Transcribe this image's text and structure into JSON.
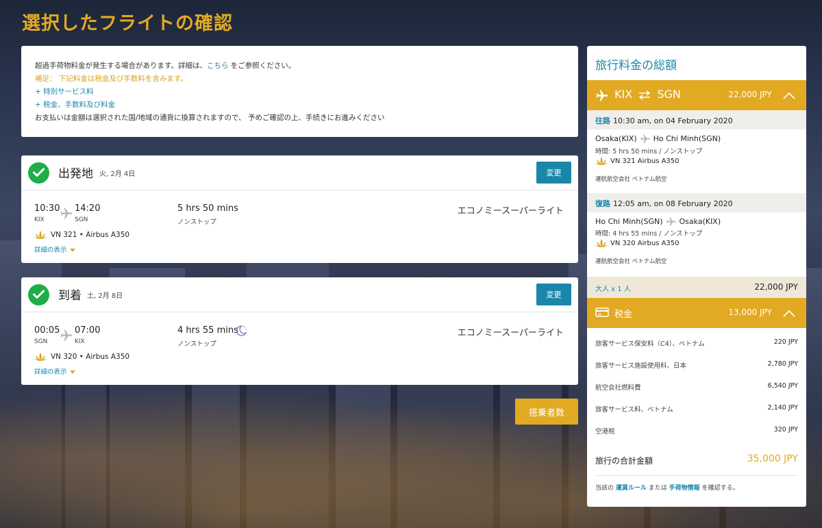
{
  "page": {
    "title": "選択したフライトの確認"
  },
  "notice": {
    "line1_pre": "超過手荷物料金が発生する場合があります。詳細は、",
    "line1_link": "こちら",
    "line1_post": "をご参照ください。",
    "line2": "補足： 下記料金は税金及び手数料を含みます。",
    "line3": "+ 特別サービス料",
    "line4": "+ 税金、手数料及び料金",
    "line5": "お支払いは金額は選択された国/地域の通貨に換算されますので、 予めご確認の上、手続きにお進みください"
  },
  "segments": [
    {
      "title": "出発地",
      "date": "火, 2月 4日",
      "change_label": "変更",
      "dep_time": "10:30",
      "arr_time": "14:20",
      "dep_airport": "KIX",
      "arr_airport": "SGN",
      "duration": "5 hrs 50 mins",
      "stops": "ノンストップ",
      "cabin": "エコノミースーパーライト",
      "flight_no": "VN 321",
      "aircraft": "Airbus A350",
      "details_label": "詳細の表示"
    },
    {
      "title": "到着",
      "date": "土, 2月 8日",
      "change_label": "変更",
      "dep_time": "00:05",
      "arr_time": "07:00",
      "dep_airport": "SGN",
      "arr_airport": "KIX",
      "duration": "4 hrs 55 mins",
      "stops": "ノンストップ",
      "cabin": "エコノミースーパーライト",
      "flight_no": "VN 320",
      "aircraft": "Airbus A350",
      "details_label": "詳細の表示"
    }
  ],
  "passenger_button": "搭乗者数",
  "summary": {
    "title": "旅行料金の総額",
    "route_from": "KIX",
    "route_to": "SGN",
    "route_amount": "22,000 JPY",
    "outbound": {
      "dir": "往路",
      "when": "10:30 am, on 04 February 2020",
      "from": "Osaka(KIX)",
      "to": "Ho Chi Minh(SGN)",
      "time": "時間: 5 hrs 50 mins / ノンストップ",
      "flight": "VN 321 Airbus A350",
      "operator": "運航航空会社 ベトナム航空"
    },
    "inbound": {
      "dir": "復路",
      "when": "12:05 am, on 08 February 2020",
      "from": "Ho Chi Minh(SGN)",
      "to": "Osaka(KIX)",
      "time": "時間: 4 hrs 55 mins / ノンストップ",
      "flight": "VN 320 Airbus A350",
      "operator": "運航航空会社 ベトナム航空"
    },
    "adult_label": "大人 x 1 人",
    "adult_amount": "22,000 JPY",
    "tax_label": "税金",
    "tax_amount": "13,000 JPY",
    "taxes": [
      {
        "name": "旅客サービス保安料（C4）、ベトナム",
        "value": "220 JPY"
      },
      {
        "name": "旅客サービス施設使用料、日本",
        "value": "2,780 JPY"
      },
      {
        "name": "航空会社燃料費",
        "value": "6,540 JPY"
      },
      {
        "name": "旅客サービス料、ベトナム",
        "value": "2,140 JPY"
      },
      {
        "name": "空港税",
        "value": "320 JPY"
      }
    ],
    "total_label": "旅行の合計金額",
    "total_amount": "35,000 JPY",
    "foot_pre": "当該の",
    "foot_link1": "運賃ルール",
    "foot_mid": "または",
    "foot_link2": "手荷物情報",
    "foot_post": "を確認する。"
  },
  "colors": {
    "gold": "#e2aa22",
    "teal": "#1a87aa",
    "green": "#1eae48"
  }
}
